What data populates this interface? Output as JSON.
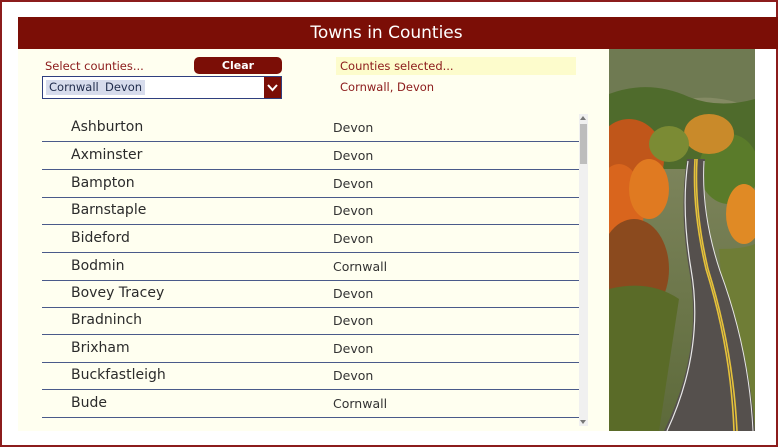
{
  "app": {
    "title": "Towns in Counties"
  },
  "filter": {
    "label": "Select counties...",
    "clear_label": "Clear",
    "chips": [
      "Cornwall",
      "Devon"
    ]
  },
  "selection": {
    "label": "Counties selected...",
    "value": "Cornwall, Devon"
  },
  "towns": [
    {
      "town": "Ashburton",
      "county": "Devon"
    },
    {
      "town": "Axminster",
      "county": "Devon"
    },
    {
      "town": "Bampton",
      "county": "Devon"
    },
    {
      "town": "Barnstaple",
      "county": "Devon"
    },
    {
      "town": "Bideford",
      "county": "Devon"
    },
    {
      "town": "Bodmin",
      "county": "Cornwall"
    },
    {
      "town": "Bovey Tracey",
      "county": "Devon"
    },
    {
      "town": "Bradninch",
      "county": "Devon"
    },
    {
      "town": "Brixham",
      "county": "Devon"
    },
    {
      "town": "Buckfastleigh",
      "county": "Devon"
    },
    {
      "town": "Bude",
      "county": "Cornwall"
    }
  ],
  "colors": {
    "brand": "#7b0e06",
    "panel": "#fffff0",
    "accent_text": "#8b1a1a"
  },
  "icons": {
    "dropdown": "chevron-down-icon"
  }
}
